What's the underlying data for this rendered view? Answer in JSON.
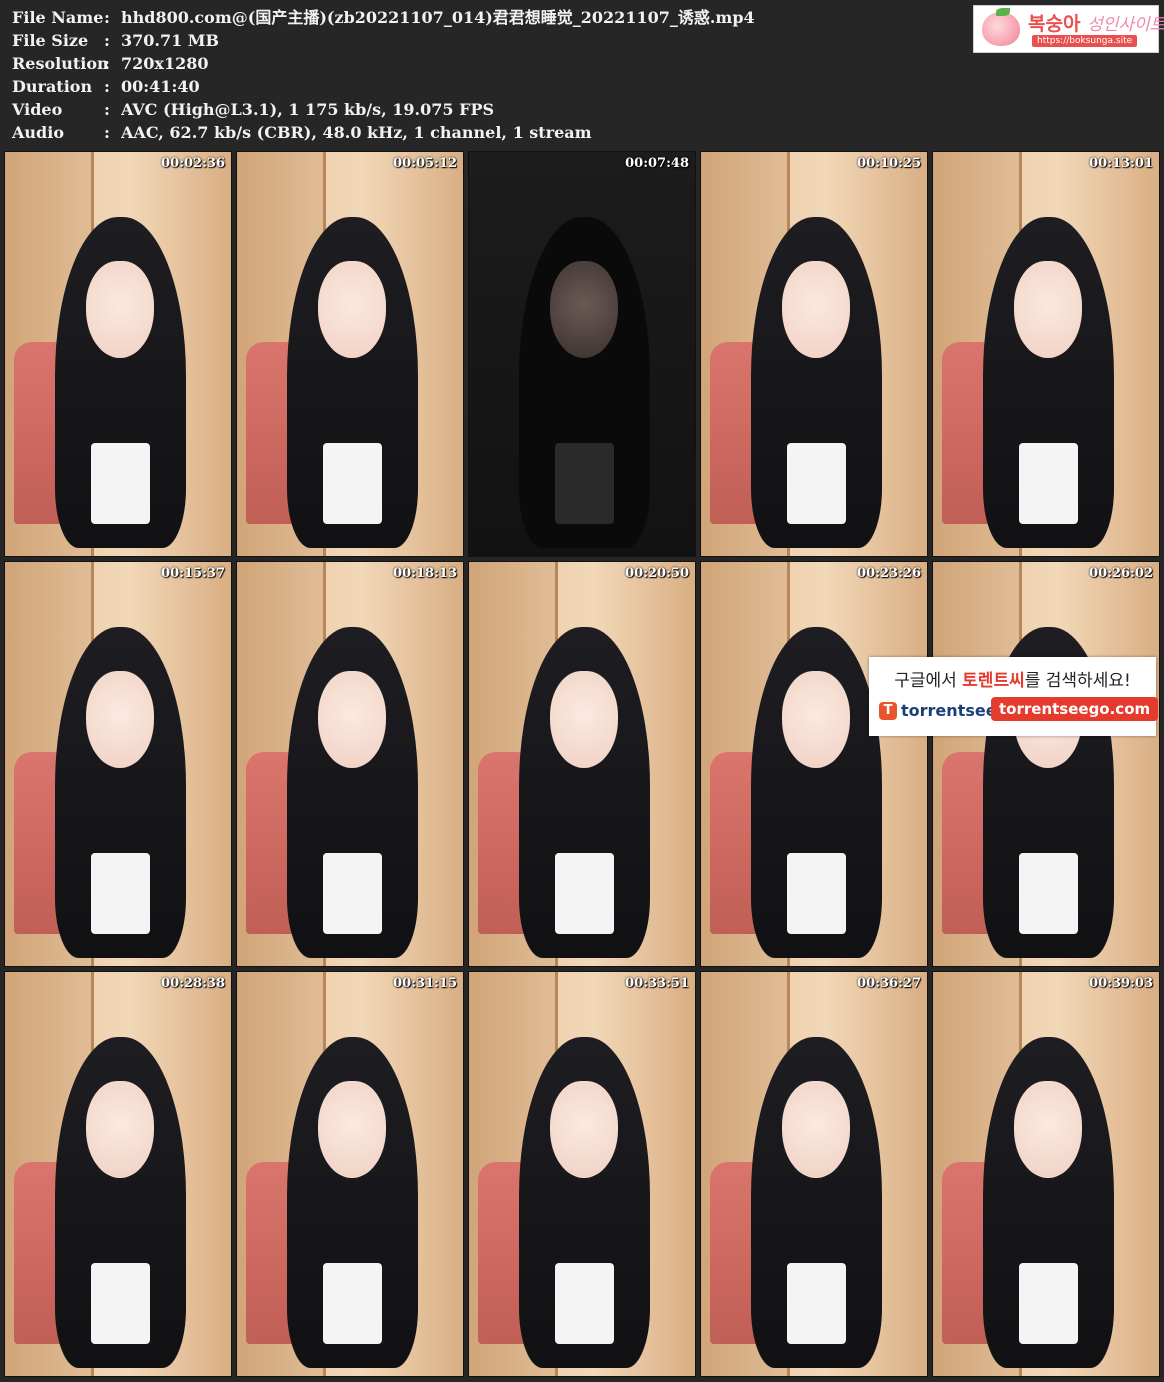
{
  "file_info": {
    "separator": ":",
    "rows": [
      {
        "key": "File Name",
        "value": "hhd800.com@(国产主播)(zb20221107_014)君君想睡觉_20221107_诱惑.mp4"
      },
      {
        "key": "File Size",
        "value": "370.71 MB"
      },
      {
        "key": "Resolution",
        "value": "720x1280"
      },
      {
        "key": "Duration",
        "value": "00:41:40"
      },
      {
        "key": "Video",
        "value": "AVC (High@L3.1), 1 175 kb/s, 19.075 FPS"
      },
      {
        "key": "Audio",
        "value": "AAC, 62.7 kb/s (CBR), 48.0 kHz, 1 channel, 1 stream"
      }
    ]
  },
  "logo": {
    "title_main": "복숭아",
    "title_accent": "성인사이트",
    "url": "https://boksunga.site"
  },
  "thumbnails": {
    "timestamps": [
      "00:02:36",
      "00:05:12",
      "00:07:48",
      "00:10:25",
      "00:13:01",
      "00:15:37",
      "00:18:13",
      "00:20:50",
      "00:23:26",
      "00:26:02",
      "00:28:38",
      "00:31:15",
      "00:33:51",
      "00:36:27",
      "00:39:03"
    ]
  },
  "ad": {
    "line1_prefix": "구글에서 ",
    "line1_highlight": "토렌트씨",
    "line1_suffix": "를 검색하세요!",
    "brand_icon": "T",
    "brand": "torrentsee",
    "url": "torrentseego.com"
  },
  "colors": {
    "background": "#262626",
    "text": "#f2f2f2",
    "ad_red": "#e53b2c",
    "logo_red": "#e8504f"
  }
}
